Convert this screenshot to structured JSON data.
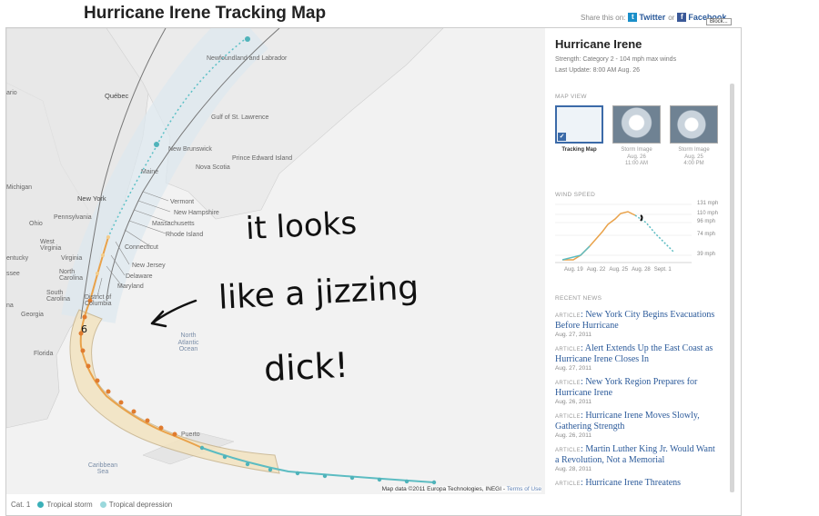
{
  "page": {
    "title": "Hurricane Irene Tracking Map"
  },
  "share": {
    "prefix": "Share this on:",
    "twitter": "Twitter",
    "or": "or",
    "facebook": "Facebook",
    "block": "Block..."
  },
  "map": {
    "labels": {
      "newfoundland": "Newfoundland and Labrador",
      "quebec": "Québec",
      "gulf": "Gulf of St. Lawrence",
      "nb": "New Brunswick",
      "pei": "Prince Edward Island",
      "ns": "Nova Scotia",
      "maine": "Maine",
      "michigan": "Michigan",
      "ny": "New York",
      "vermont": "Vermont",
      "nh": "New Hampshire",
      "ma": "Massachusetts",
      "ri": "Rhode Island",
      "ct": "Connecticut",
      "nj": "New Jersey",
      "de": "Delaware",
      "md": "Maryland",
      "dc": "District of Columbia",
      "pa": "Pennsylvania",
      "ohio": "Ohio",
      "wv": "West Virginia",
      "va": "Virginia",
      "ky": "Kentucky",
      "nc": "North Carolina",
      "sc": "South Carolina",
      "ga": "Georgia",
      "fl": "Florida",
      "ocean": "North Atlantic Ocean",
      "puerto": "Puerto",
      "caribbean": "Caribbean Sea",
      "ario": "ario",
      "ssee": "ssee",
      "ucky": "entucky",
      "na": "na"
    },
    "attribution": "Map data ©2011 Europa Technologies, INEGI -",
    "terms": "Terms of Use"
  },
  "scribble": {
    "line1": "it looks",
    "line2": "like a jizzing",
    "line3": "dick!"
  },
  "legend": {
    "cat": "Cat. 1",
    "ts": "Tropical storm",
    "td": "Tropical depression",
    "ts_color": "#3bb0b8",
    "td_color": "#9ad8dc"
  },
  "panel": {
    "title": "Hurricane Irene",
    "strength": "Strength: Category 2 - 104 mph max winds",
    "updated": "Last Update: 8:00 AM Aug. 26",
    "map_view_label": "MAP VIEW",
    "thumbs": [
      {
        "label": "Tracking Map",
        "sub1": "",
        "sub2": ""
      },
      {
        "label": "Storm Image",
        "sub1": "Aug. 26",
        "sub2": "11:00 AM"
      },
      {
        "label": "Storm Image",
        "sub1": "Aug. 25",
        "sub2": "4:00 PM"
      }
    ],
    "wind_label": "WIND SPEED",
    "wind_ticks": [
      "131 mph",
      "110 mph",
      "96 mph",
      "74 mph",
      "39 mph"
    ],
    "wind_xticks": [
      "Aug. 19",
      "Aug. 22",
      "Aug. 25",
      "Aug. 28",
      "Sept. 1"
    ],
    "news_label": "RECENT NEWS",
    "news": [
      {
        "tag": "ARTICLE",
        "headline": "New York City Begins Evacuations Before Hurricane",
        "date": "Aug. 27, 2011"
      },
      {
        "tag": "ARTICLE",
        "headline": "Alert Extends Up the East Coast as Hurricane Irene Closes In",
        "date": "Aug. 27, 2011"
      },
      {
        "tag": "ARTICLE",
        "headline": "New York Region Prepares for Hurricane Irene",
        "date": "Aug. 26, 2011"
      },
      {
        "tag": "ARTICLE",
        "headline": "Hurricane Irene Moves Slowly, Gathering Strength",
        "date": "Aug. 26, 2011"
      },
      {
        "tag": "ARTICLE",
        "headline": "Martin Luther King Jr. Would Want a Revolution, Not a Memorial",
        "date": "Aug. 28, 2011"
      },
      {
        "tag": "ARTICLE",
        "headline": "Hurricane Irene Threatens",
        "date": ""
      }
    ]
  }
}
